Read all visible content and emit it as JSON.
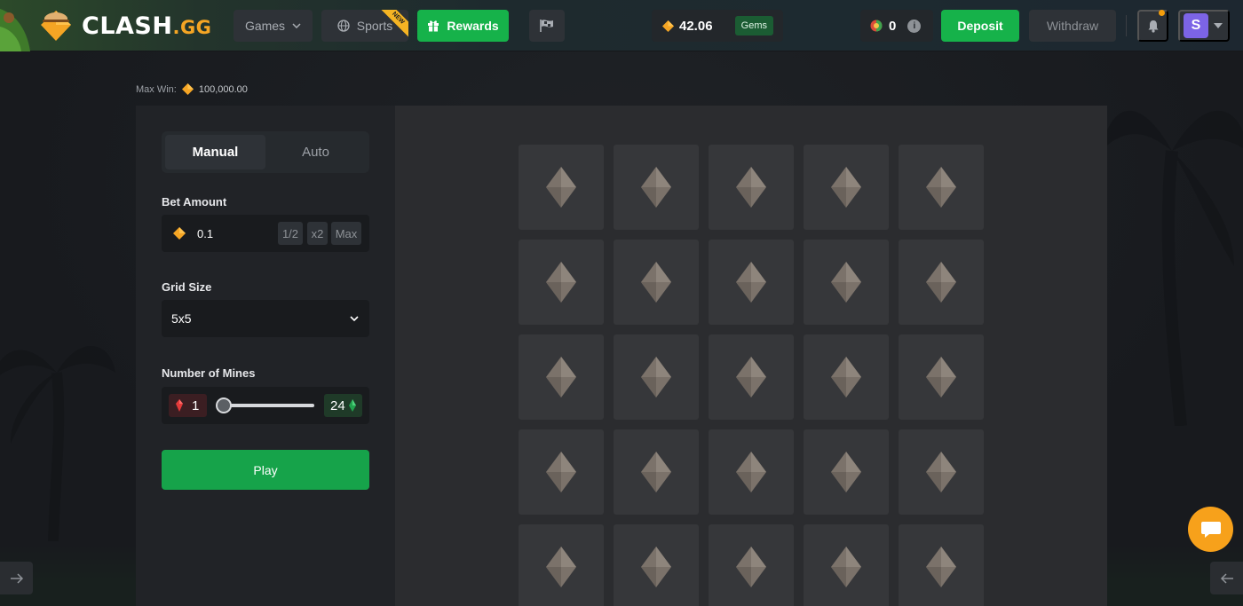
{
  "brand": {
    "name": "CLASH",
    "tld": ".GG"
  },
  "nav": {
    "games_label": "Games",
    "sports_label": "Sports",
    "sports_badge": "NEW",
    "rewards_label": "Rewards"
  },
  "wallet": {
    "balance": "42.06",
    "currency": "Gems",
    "coins": "0"
  },
  "actions": {
    "deposit_label": "Deposit",
    "withdraw_label": "Withdraw",
    "avatar_initial": "S"
  },
  "game": {
    "max_win_label": "Max Win:",
    "max_win_value": "100,000.00",
    "tabs": [
      {
        "label": "Manual",
        "active": true
      },
      {
        "label": "Auto",
        "active": false
      }
    ],
    "bet_amount_label": "Bet Amount",
    "bet_amount_value": "0.1",
    "bet_modifiers": {
      "half": "1/2",
      "double": "x2",
      "max": "Max"
    },
    "grid_size_label": "Grid Size",
    "grid_size_value": "5x5",
    "mines_label": "Number of Mines",
    "mines_count": "1",
    "gems_count": "24",
    "mines_slider_fraction": 0.0,
    "play_label": "Play"
  },
  "board": {
    "rows": 5,
    "cols": 5
  },
  "colors": {
    "accent_green": "#16b24a",
    "gem_orange": "#f5a524",
    "chat_orange": "#f7a11b",
    "avatar_purple": "#7c64e6"
  },
  "icons": {
    "nav_games": "chevron-down-icon",
    "nav_sports": "globe-icon",
    "nav_rewards": "gift-icon",
    "nav_race": "flag-icon",
    "currency": "gem-icon",
    "coins": "coin-icon",
    "info": "info-icon",
    "notifications": "bell-icon",
    "user_menu": "caret-down-icon",
    "tile": "diamond-icon",
    "mine": "bomb-icon",
    "gem": "emerald-icon",
    "chat": "chat-bubble-icon",
    "left_arrow": "arrow-right-icon",
    "right_arrow": "arrow-left-icon"
  }
}
